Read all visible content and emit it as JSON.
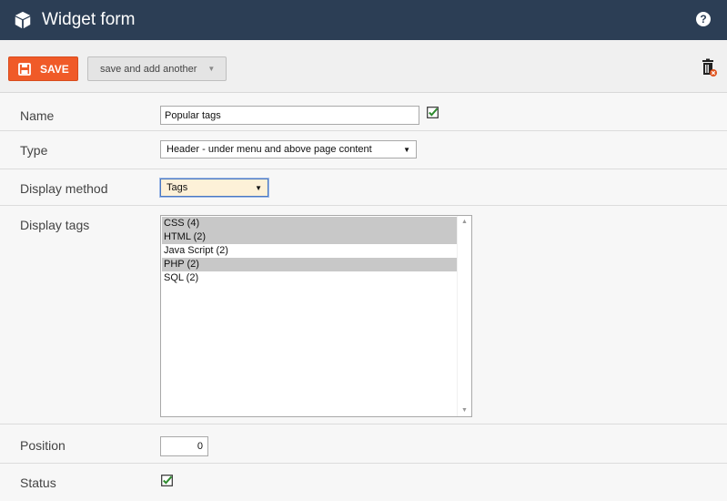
{
  "header": {
    "title": "Widget form",
    "help_glyph": "?"
  },
  "toolbar": {
    "save_label": "SAVE",
    "save_another_label": "save and add another"
  },
  "form": {
    "name": {
      "label": "Name",
      "value": "Popular tags",
      "checked": true
    },
    "type": {
      "label": "Type",
      "selected": "Header - under menu and above page content"
    },
    "method": {
      "label": "Display method",
      "selected": "Tags"
    },
    "tags": {
      "label": "Display tags",
      "options": [
        {
          "text": "CSS (4)",
          "selected": true
        },
        {
          "text": "HTML (2)",
          "selected": true
        },
        {
          "text": "Java Script (2)",
          "selected": false
        },
        {
          "text": "PHP (2)",
          "selected": true
        },
        {
          "text": "SQL (2)",
          "selected": false
        }
      ]
    },
    "position": {
      "label": "Position",
      "value": "0"
    },
    "status": {
      "label": "Status",
      "checked": true
    }
  },
  "colors": {
    "header_bg": "#2c3e55",
    "save_bg": "#f05a28",
    "check_green": "#2e8b2e"
  }
}
